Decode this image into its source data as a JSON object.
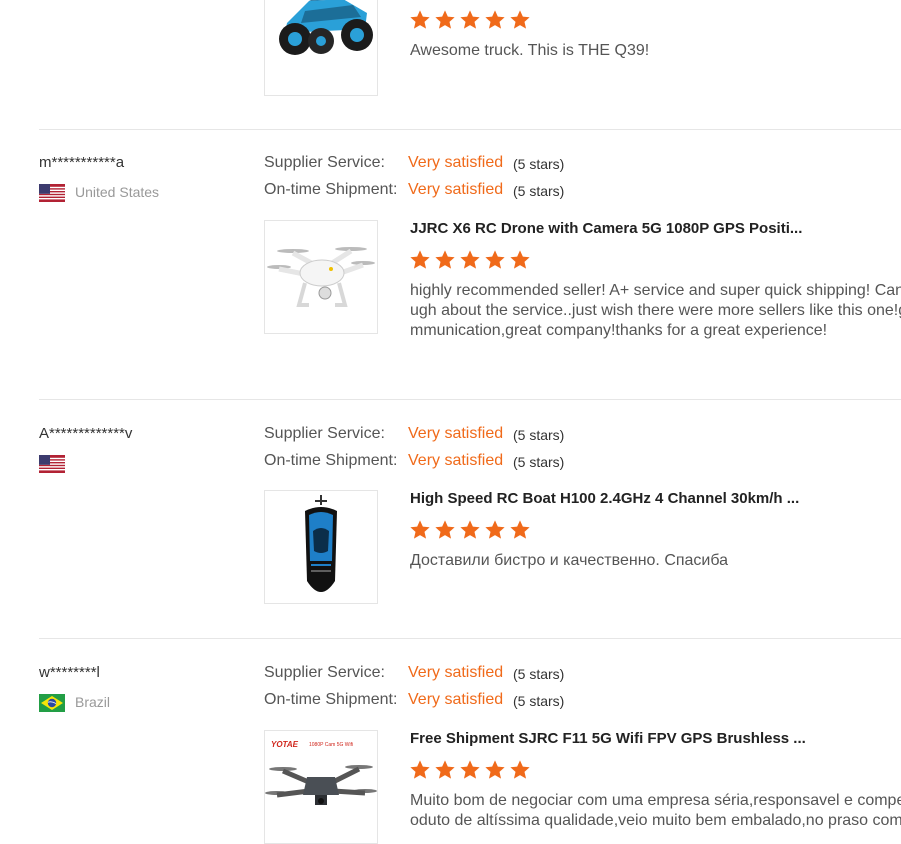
{
  "labels": {
    "supplier_service": "Supplier Service:",
    "on_time_shipment": "On-time Shipment:"
  },
  "colors": {
    "accent": "#f06a1a",
    "divider": "#e6e6e6"
  },
  "first_partial": {
    "stars": 5,
    "review_lines": [
      "Awesome truck.  This is THE Q39!"
    ],
    "product_image": "rc-truck-blue"
  },
  "feedbacks": [
    {
      "buyer": "m***********a",
      "flag": "flag-usa",
      "country": "United States",
      "supplier_value": "Very satisfied",
      "supplier_stars": "(5 stars)",
      "shipment_value": "Very satisfied",
      "shipment_stars": "(5 stars)",
      "product_title": "JJRC X6 RC Drone with Camera 5G 1080P GPS Positi...",
      "product_image": "white-drone",
      "stars": 5,
      "review_lines": [
        "highly recommended seller! A+ service and super quick shipping! Can't",
        "ugh about the service..just wish there were more sellers like this one!g",
        "mmunication,great company!thanks for a great experience!"
      ]
    },
    {
      "buyer": "A*************v",
      "flag": "flag-usa",
      "country": "",
      "supplier_value": "Very satisfied",
      "supplier_stars": "(5 stars)",
      "shipment_value": "Very satisfied",
      "shipment_stars": "(5 stars)",
      "product_title": "High Speed RC Boat H100 2.4GHz 4 Channel 30km/h ...",
      "product_image": "rc-boat-blue",
      "stars": 5,
      "review_lines": [
        "Доставили бистро и качественно. Спасиба"
      ]
    },
    {
      "buyer": "w********l",
      "flag": "flag-brazil",
      "country": "Brazil",
      "supplier_value": "Very satisfied",
      "supplier_stars": "(5 stars)",
      "shipment_value": "Very satisfied",
      "shipment_stars": "(5 stars)",
      "product_title": "Free Shipment SJRC F11 5G Wifi FPV GPS Brushless ...",
      "product_image": "gray-drone",
      "product_image_brand": "YOTAE",
      "product_image_tagline": "1080P Cam 5G Wifi",
      "stars": 5,
      "review_lines": [
        "Muito bom de negociar com uma empresa séria,responsavel e compe",
        "oduto de altíssima qualidade,veio muito bem embalado,no praso com"
      ]
    }
  ]
}
